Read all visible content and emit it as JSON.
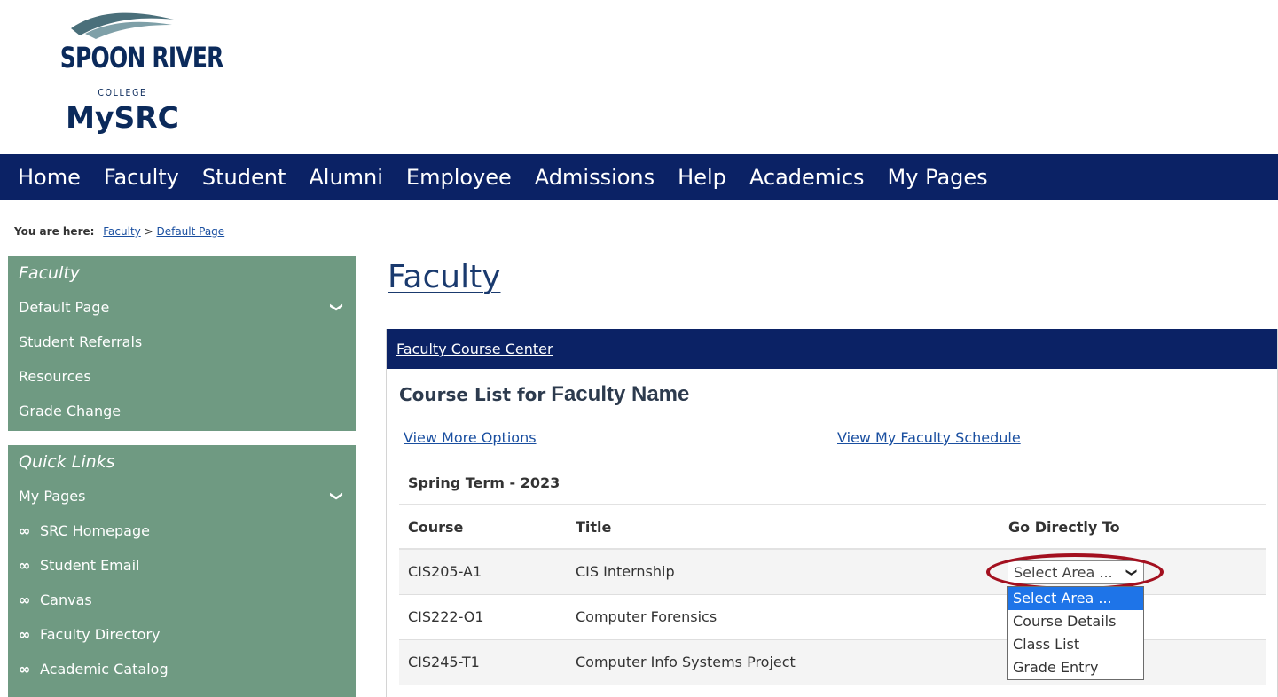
{
  "logo": {
    "name": "SPOON RIVER",
    "college": "COLLEGE",
    "portal": "MySRC"
  },
  "nav": {
    "items": [
      "Home",
      "Faculty",
      "Student",
      "Alumni",
      "Employee",
      "Admissions",
      "Help",
      "Academics",
      "My Pages"
    ]
  },
  "breadcrumb": {
    "label": "You are here:",
    "crumbs": [
      "Faculty",
      "Default Page"
    ],
    "separator": ">"
  },
  "sidebar": {
    "faculty": {
      "heading": "Faculty",
      "items": [
        "Default Page",
        "Student Referrals",
        "Resources",
        "Grade Change"
      ]
    },
    "quick_links": {
      "heading": "Quick Links",
      "items": [
        "My Pages",
        "SRC Homepage",
        "Student Email",
        "Canvas",
        "Faculty Directory",
        "Academic Catalog"
      ]
    }
  },
  "main": {
    "title": "Faculty",
    "panel_title": "Faculty Course Center",
    "course_list_label": "Course List for",
    "faculty_name": "Faculty Name",
    "view_more_options": "View More Options",
    "view_schedule": "View My Faculty Schedule",
    "term": "Spring Term - 2023",
    "table": {
      "headers": [
        "Course",
        "Title",
        "Go Directly To"
      ],
      "rows": [
        {
          "course": "CIS205-A1",
          "title": "CIS Internship"
        },
        {
          "course": "CIS222-O1",
          "title": "Computer Forensics"
        },
        {
          "course": "CIS245-T1",
          "title": "Computer Info Systems Project"
        }
      ]
    },
    "go_select": {
      "value": "Select Area ...",
      "options": [
        "Select Area ...",
        "Course Details",
        "Class List",
        "Grade Entry"
      ],
      "selected_index": 0
    }
  },
  "colors": {
    "nav_bg": "#0b2265",
    "sidebar_bg": "#6f9a82",
    "link": "#1a4fa0",
    "highlight_ring": "#a3101f",
    "option_selected": "#1e74e8"
  }
}
